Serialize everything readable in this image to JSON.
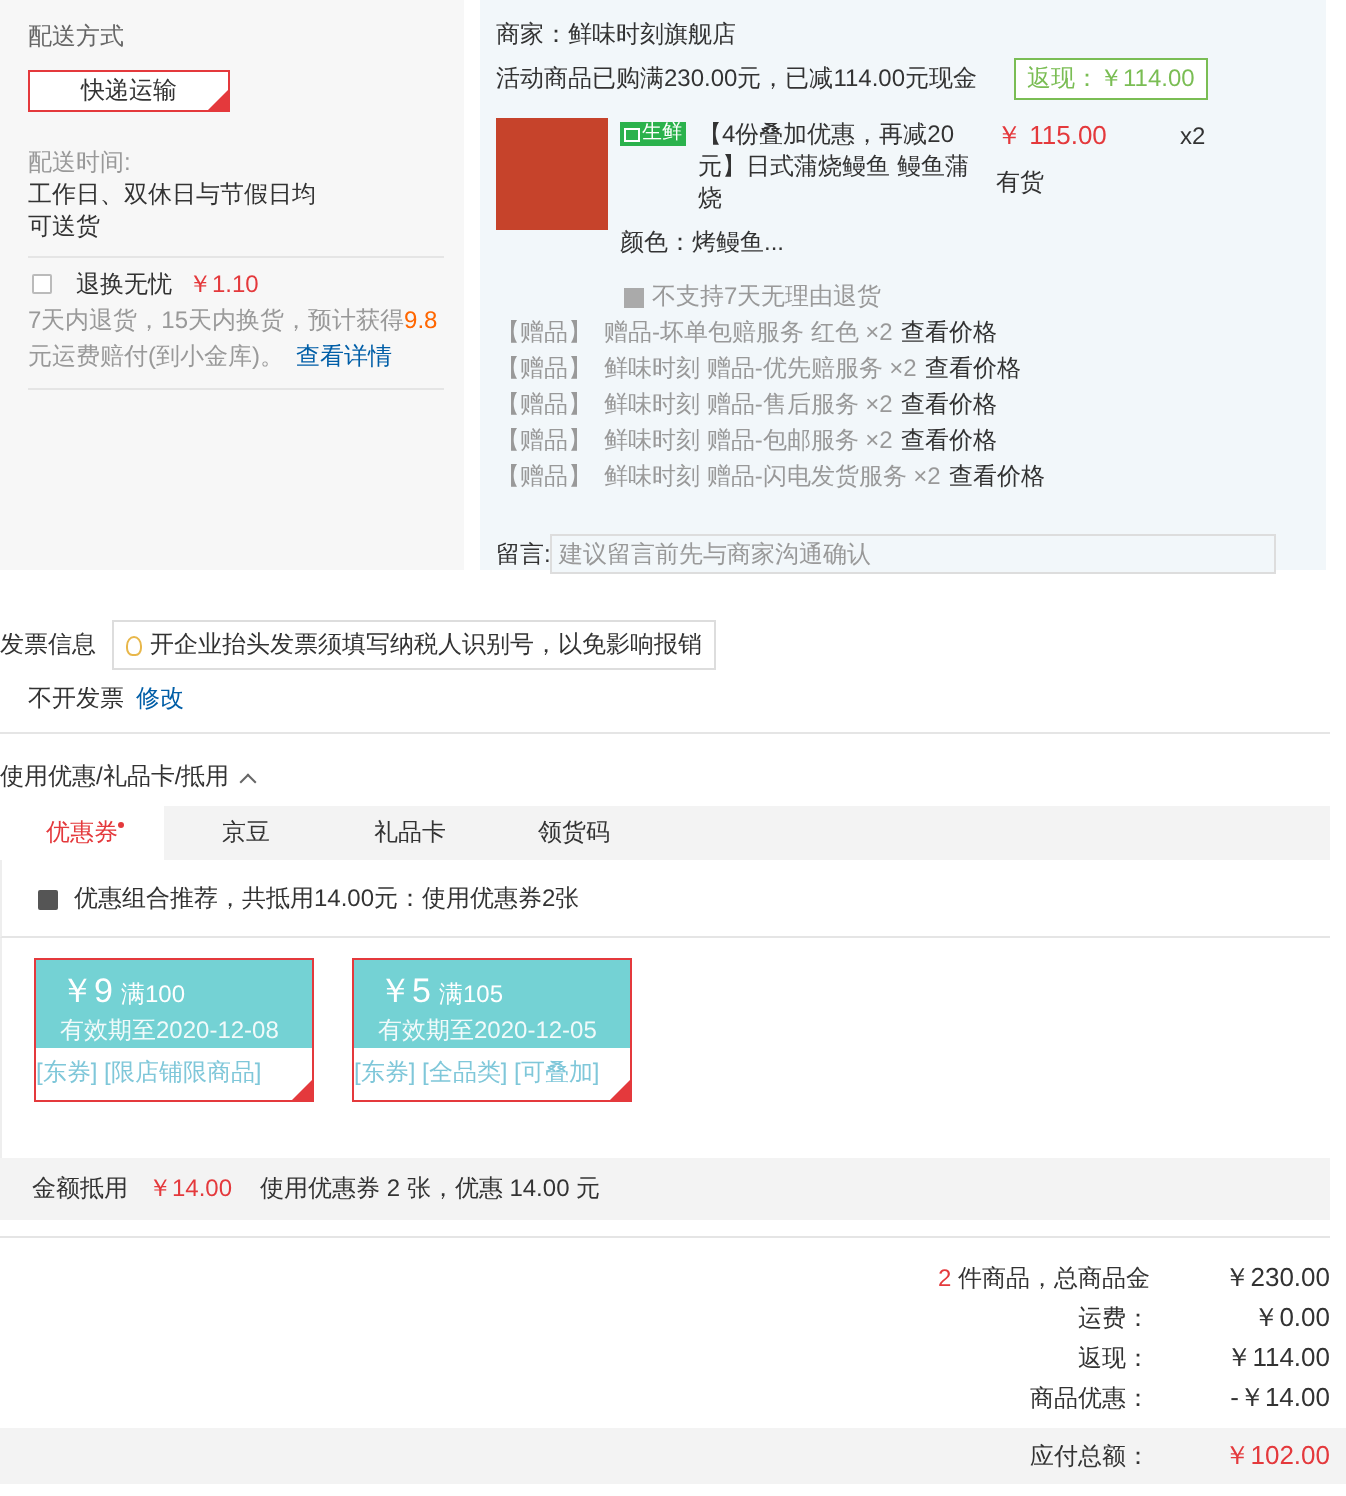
{
  "delivery": {
    "title": "配送方式",
    "method": {
      "label": "快递运输",
      "selected": true
    },
    "time_label": "配送时间:",
    "time_value": "工作日、双休日与节假日均可送货",
    "return_service": {
      "label": "退换无忧",
      "price": "￥1.10",
      "checked": false,
      "desc_pre": "7天内退货，15天内换货，预计获得",
      "desc_amount": "9.8",
      "desc_post": "元运费赔付(到小金库)。",
      "link": "查看详情"
    }
  },
  "shop": {
    "seller": "商家：鲜味时刻旗舰店",
    "promo": "活动商品已购满230.00元，已减114.00元现金",
    "cashback": "返现：￥114.00",
    "product": {
      "tag": "生鲜",
      "title": "【4份叠加优惠，再减20元】日式蒲烧鳗鱼 鳗鱼蒲烧",
      "price": "￥ 115.00",
      "qty": "x2",
      "stock": "有货",
      "variant": "颜色：烤鳗鱼...",
      "no_return": "不支持7天无理由退货"
    },
    "gifts": [
      {
        "prefix": "【赠品】",
        "name": "赠品-坏单包赔服务 红色 ×2",
        "link": "查看价格"
      },
      {
        "prefix": "【赠品】",
        "name": "鲜味时刻 赠品-优先赔服务 ×2",
        "link": "查看价格"
      },
      {
        "prefix": "【赠品】",
        "name": "鲜味时刻 赠品-售后服务 ×2",
        "link": "查看价格"
      },
      {
        "prefix": "【赠品】",
        "name": "鲜味时刻 赠品-包邮服务 ×2",
        "link": "查看价格"
      },
      {
        "prefix": "【赠品】",
        "name": "鲜味时刻 赠品-闪电发货服务 ×2",
        "link": "查看价格"
      }
    ],
    "message": {
      "label": "留言:",
      "placeholder": "建议留言前先与商家沟通确认"
    }
  },
  "invoice": {
    "title": "发票信息",
    "tip": "开企业抬头发票须填写纳税人识别号，以免影响报销",
    "value": "不开发票",
    "edit": "修改"
  },
  "discounts": {
    "title": "使用优惠/礼品卡/抵用",
    "tabs": [
      {
        "label": "优惠券",
        "selected": true
      },
      {
        "label": "京豆",
        "selected": false
      },
      {
        "label": "礼品卡",
        "selected": false
      },
      {
        "label": "领货码",
        "selected": false
      }
    ],
    "recommend": {
      "checked": true,
      "text": "优惠组合推荐，共抵用14.00元：使用优惠券2张"
    },
    "coupons": [
      {
        "amount": "￥9",
        "condition": "满100",
        "expiry": "有效期至2020-12-08",
        "tags": "[东券] [限店铺限商品]",
        "selected": true
      },
      {
        "amount": "￥5",
        "condition": "满105",
        "expiry": "有效期至2020-12-05",
        "tags": "[东券] [全品类] [可叠加]",
        "selected": true
      }
    ],
    "summary_label": "金额抵用",
    "summary_amount": "￥14.00",
    "summary_text": "使用优惠券 2 张，优惠 14.00 元"
  },
  "totals": {
    "count": "2",
    "count_label": "件商品，总商品金",
    "goods_total": "￥230.00",
    "rows": [
      {
        "label": "运费：",
        "value": "￥0.00"
      },
      {
        "label": "返现：",
        "value": "￥114.00"
      },
      {
        "label": "商品优惠：",
        "value": "-￥14.00"
      }
    ],
    "payable_label": "应付总额：",
    "payable": "￥102.00"
  }
}
